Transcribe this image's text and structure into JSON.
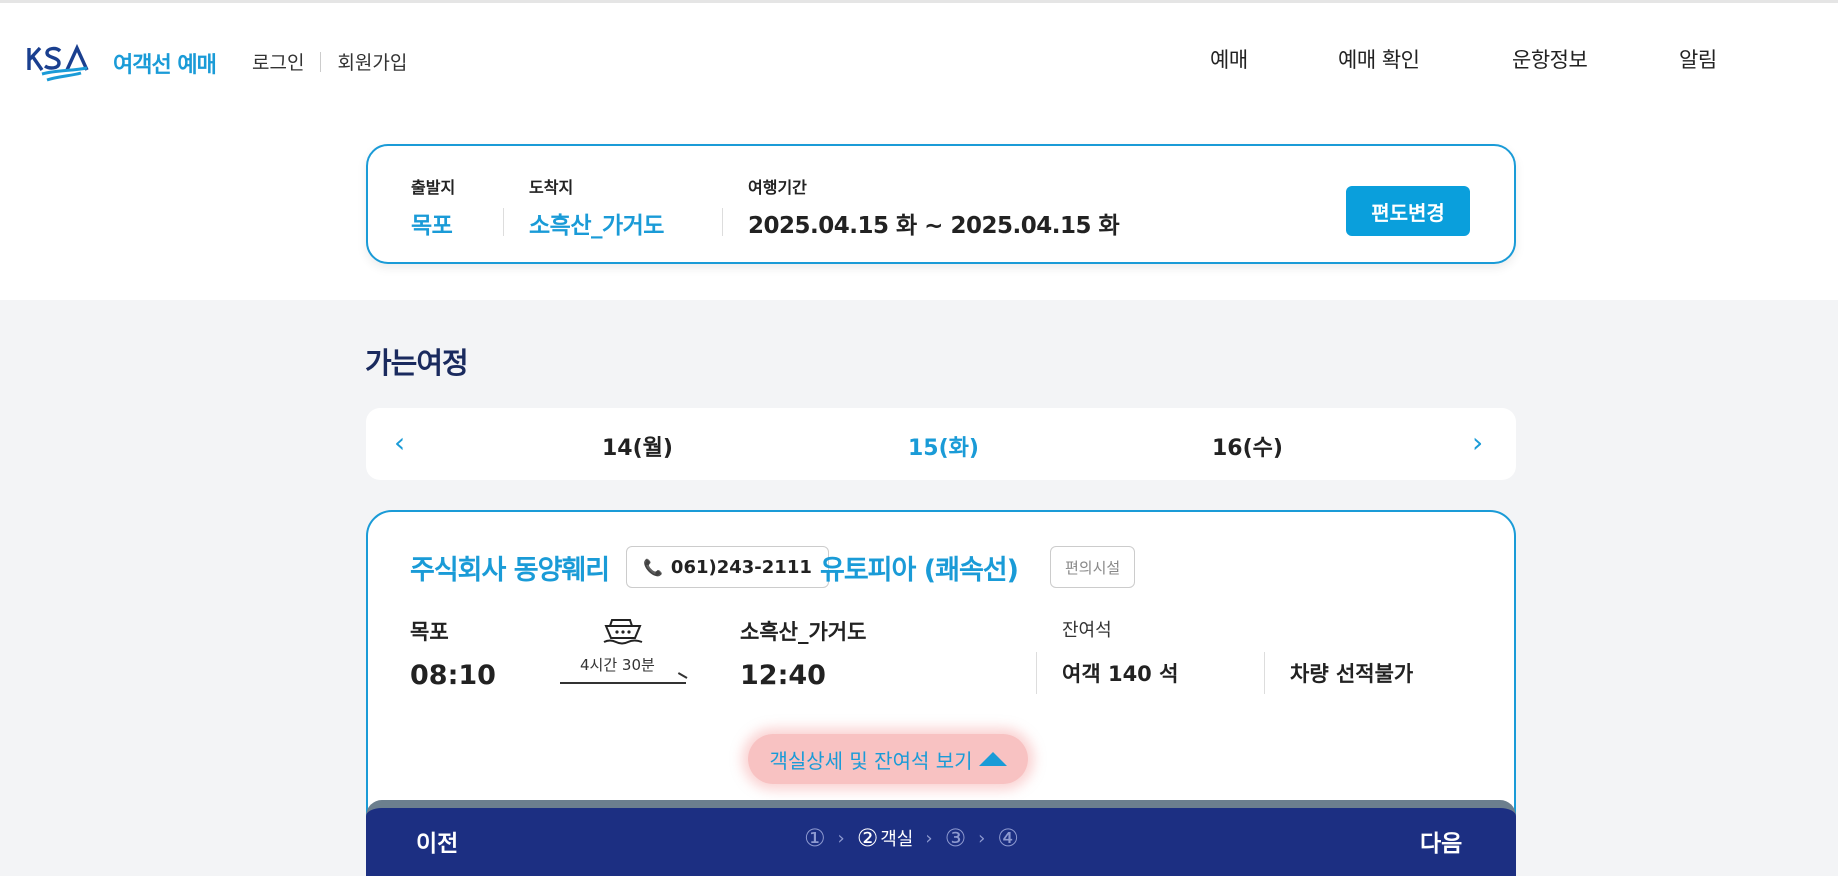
{
  "header": {
    "logo_text": "여객선 예매",
    "login": "로그인",
    "signup": "회원가입",
    "nav": [
      "예매",
      "예매 확인",
      "운항정보",
      "알림"
    ]
  },
  "search": {
    "origin_label": "출발지",
    "origin": "목포",
    "destination_label": "도착지",
    "destination": "소흑산_가거도",
    "period_label": "여행기간",
    "period": "2025.04.15 화 ~ 2025.04.15 화",
    "change_button": "편도변경"
  },
  "trip": {
    "title": "가는여정",
    "dates": [
      "14(월)",
      "15(화)",
      "16(수)"
    ],
    "selected_date": "15(화)"
  },
  "ferry": {
    "company": "주식회사 동양훼리",
    "phone": "061)243-2111",
    "vessel": "유토피아 (쾌속선)",
    "facilities_button": "편의시설",
    "depart_port": "목포",
    "depart_time": "08:10",
    "duration": "4시간 30분",
    "arrive_port": "소흑산_가거도",
    "arrive_time": "12:40",
    "remaining_label": "잔여석",
    "passenger_seats": "여객 140 석",
    "vehicle_seats": "차량 선적불가",
    "detail_link": "객실상세 및 잔여석 보기"
  },
  "steps": {
    "prev": "이전",
    "next": "다음",
    "step1": "①",
    "step2": "②",
    "step2_label": "객실",
    "step3": "③",
    "step4": "④"
  },
  "colors": {
    "accent": "#1a9bd7",
    "navy": "#1c2f82"
  }
}
